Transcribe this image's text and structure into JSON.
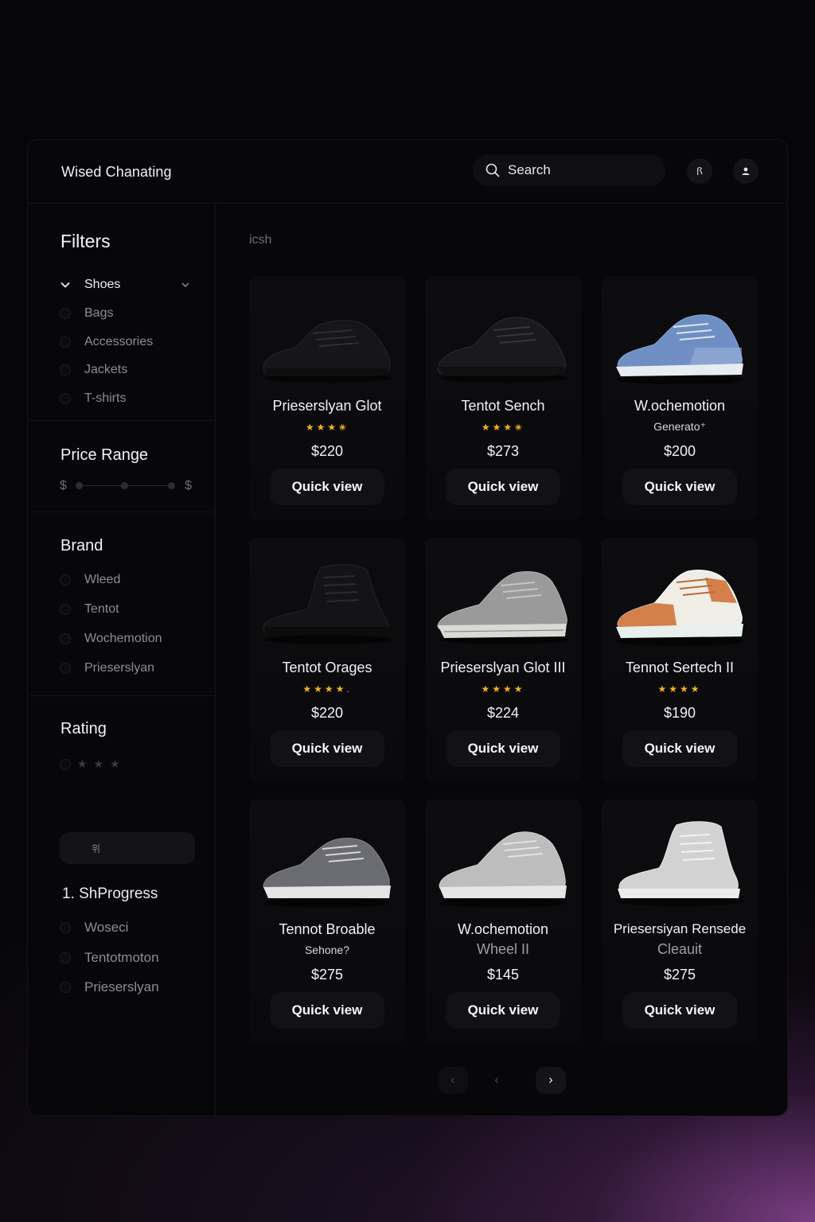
{
  "app": {
    "brand_title": "Wised Chanating"
  },
  "header": {
    "search_label": "Search",
    "icon_button_label": "ꟗ"
  },
  "sidebar": {
    "filters_title": "Filters",
    "categories": [
      {
        "label": "Shoes",
        "active": true
      },
      {
        "label": "Bags"
      },
      {
        "label": "Accessories"
      },
      {
        "label": "Jackets"
      },
      {
        "label": "T-shirts"
      }
    ],
    "price_range_title": "Price Range",
    "price_min_symbol": "$",
    "price_max_symbol": "$",
    "brand_title": "Brand",
    "brands": [
      "Wleed",
      "Tentot",
      "Wochemotion",
      "Prieserslyan"
    ],
    "rating_title": "Rating",
    "button_label": "위",
    "progress_title": "1. ShProgress",
    "progress_items": [
      "Woseci",
      "Tentotmoton",
      "Prieserslyan"
    ]
  },
  "main": {
    "section_label": "icsh",
    "products": [
      {
        "name": "Prieserslyan Glot",
        "rating_stars": "★★★✬",
        "price": "$220",
        "quick_view": "Quick view",
        "color": "#161618"
      },
      {
        "name": "Tentot Sench",
        "rating_stars": "★★★✬",
        "price": "$273",
        "quick_view": "Quick view",
        "color": "#1a1a1c"
      },
      {
        "name": "W.ochemotion",
        "subtitle": "Generato⁺",
        "price": "$200",
        "quick_view": "Quick view",
        "color": "#6f8fc4"
      },
      {
        "name": "Tentot Orages",
        "rating_stars": "★★★★.",
        "price": "$220",
        "quick_view": "Quick view",
        "color": "#141416"
      },
      {
        "name": "Prieserslyan Glot III",
        "rating_stars": "★★★★",
        "price": "$224",
        "quick_view": "Quick view",
        "color": "#9a9a9a"
      },
      {
        "name": "Tennot Sertech II",
        "rating_stars": "★★★★",
        "price": "$190",
        "quick_view": "Quick view",
        "color": "#d3804a"
      },
      {
        "name": "Tennot Broable",
        "subtitle": "Sehone?",
        "price": "$275",
        "quick_view": "Quick view",
        "color": "#6b6b72"
      },
      {
        "name": "W.ochemotion",
        "subtitle": "Wheel II",
        "price": "$145",
        "quick_view": "Quick view",
        "color": "#bdbdbd"
      },
      {
        "name": "Priesersiyan Rensede",
        "subtitle": "Cleauit",
        "price": "$275",
        "quick_view": "Quick view",
        "color": "#d2d2d2"
      }
    ]
  },
  "pagination": {
    "prev_symbol": "‹",
    "next_symbol": "›"
  }
}
